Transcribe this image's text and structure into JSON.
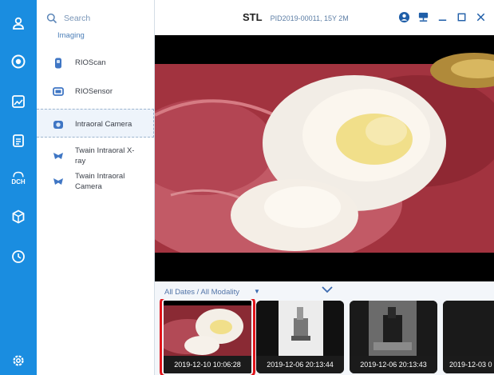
{
  "colors": {
    "rail": "#1a8de0",
    "selection_outline": "#e0141a",
    "accent_text": "#4c7fb8"
  },
  "rail": {
    "items": [
      {
        "icon": "patient-icon"
      },
      {
        "icon": "acquire-icon"
      },
      {
        "icon": "image-view-icon"
      },
      {
        "icon": "report-icon"
      },
      {
        "icon": "dch-icon",
        "label": "DCH"
      },
      {
        "icon": "3d-model-icon"
      },
      {
        "icon": "history-icon"
      },
      {
        "icon": "settings-icon"
      }
    ]
  },
  "panel": {
    "search_label": "Search",
    "section": "Imaging",
    "devices": [
      {
        "icon": "rioscan-icon",
        "label": "RIOScan"
      },
      {
        "icon": "riosensor-icon",
        "label": "RIOSensor"
      },
      {
        "icon": "intraoral-camera-icon",
        "label": "Intraoral Camera",
        "selected": true
      },
      {
        "icon": "twain-icon",
        "label": "Twain Intraoral X-ray"
      },
      {
        "icon": "twain-icon",
        "label": "Twain Intraoral Camera"
      }
    ]
  },
  "titlebar": {
    "title": "STL",
    "patient_info": "PID2019-00011, 15Y 2M",
    "controls": [
      "user-icon",
      "network-icon",
      "minimize-icon",
      "maximize-icon",
      "close-icon"
    ]
  },
  "filter": {
    "label": "All Dates / All Modality"
  },
  "thumbnails": [
    {
      "caption": "2019-12-10  10:06:28",
      "kind": "intraoral-photo",
      "selected": true
    },
    {
      "caption": "2019-12-06  20:13:44",
      "kind": "xray-light"
    },
    {
      "caption": "2019-12-06  20:13:43",
      "kind": "xray-dark"
    },
    {
      "caption": "2019-12-03  0",
      "kind": "partial"
    }
  ]
}
